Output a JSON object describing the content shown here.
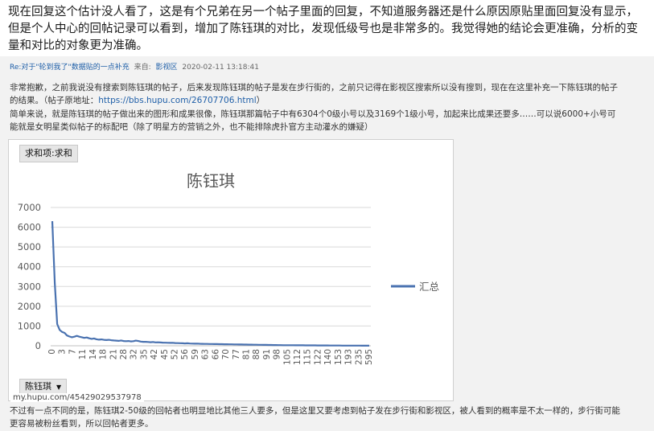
{
  "intro_text": "现在回复这个估计没人看了，这是有个兄弟在另一个帖子里面的回复，不知道服务器还是什么原因原贴里面回复没有显示，但是个人中心的回帖记录可以看到，增加了陈钰琪的对比，发现低级号也是非常多的。我觉得她的结论会更准确，分析的变量和对比的对象更为准确。",
  "reply": {
    "title": "Re:对于\"轮到我了\"数据贴的一点补充",
    "from_label": "来自:",
    "board": "影视区",
    "timestamp": "2020-02-11 13:18:41",
    "para1": "非常抱歉，之前我说没有搜索到陈钰琪的帖子，后来发现陈钰琪的帖子是发在步行街的，之前只记得在影视区搜索所以没有搜到，现在在这里补充一下陈钰琪的帖子的结果。（帖子原地址：",
    "link": "https://bbs.hupu.com/26707706.html",
    "para1_end": "）",
    "para2": "简单来说，就是陈钰琪的帖子做出来的图形和成果很像，陈钰琪那篇帖子中有6304个0级小号以及3169个1级小号，加起来比成果还要多……可以说6000+小号可能就是女明星类似帖子的标配吧（除了明星方的营销之外，也不能排除虎扑官方主动灌水的嫌疑）",
    "para3": "不过有一点不同的是，陈钰琪2-50级的回帖者也明显地比其他三人要多，但是这里又要考虑到帖子发在步行街和影视区，被人看到的概率是不太一样的，步行街可能更容易被粉丝看到，所以回帖者更多。",
    "watermark": "my.hupu.com/45429029537978"
  },
  "chart_card": {
    "sum_label": "求和项:求和",
    "filter_label": "陈钰琪",
    "filter_arrow": "▼"
  },
  "colors": {
    "series": "#4a72b0",
    "grid": "#d9d9d9",
    "axis_text": "#595959",
    "link": "#1f5fa8"
  },
  "chart_data": {
    "type": "line",
    "title": "陈钰琪",
    "legend": [
      "汇总"
    ],
    "legend_position": "right",
    "ylim": [
      0,
      7000
    ],
    "yticks": [
      0,
      1000,
      2000,
      3000,
      4000,
      5000,
      6000,
      7000
    ],
    "xticks": [
      "0",
      "3",
      "7",
      "11",
      "14",
      "18",
      "21",
      "28",
      "32",
      "35",
      "42",
      "45",
      "52",
      "56",
      "59",
      "63",
      "66",
      "70",
      "77",
      "81",
      "88",
      "91",
      "98",
      "105",
      "112",
      "115",
      "122",
      "140",
      "153",
      "193",
      "235",
      "595"
    ],
    "grid": true,
    "series": [
      {
        "name": "汇总",
        "values": [
          6304,
          3169,
          1100,
          800,
          700,
          650,
          520,
          470,
          430,
          460,
          500,
          460,
          430,
          400,
          420,
          380,
          350,
          370,
          330,
          310,
          320,
          300,
          290,
          300,
          280,
          270,
          260,
          250,
          270,
          240,
          230,
          240,
          220,
          230,
          260,
          240,
          210,
          200,
          200,
          190,
          180,
          190,
          170,
          175,
          165,
          160,
          155,
          150,
          145,
          150,
          140,
          135,
          130,
          125,
          120,
          125,
          115,
          110,
          105,
          110,
          100,
          98,
          95,
          92,
          90,
          88,
          86,
          84,
          82,
          80,
          78,
          76,
          74,
          72,
          70,
          68,
          66,
          64,
          62,
          60,
          58,
          56,
          54,
          52,
          50,
          48,
          46,
          44,
          42,
          40,
          38,
          36,
          34,
          32,
          30,
          30,
          29,
          28,
          27,
          26,
          25,
          24,
          23,
          22,
          21,
          20,
          20,
          19,
          18,
          17,
          16,
          15,
          15,
          14,
          13,
          12,
          12,
          11,
          10,
          10,
          9,
          9,
          8,
          8,
          7,
          7,
          6,
          6,
          5,
          5
        ]
      }
    ]
  }
}
